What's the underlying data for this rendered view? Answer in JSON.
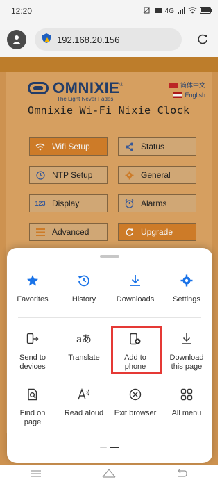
{
  "status_bar": {
    "time": "12:20",
    "network_label": "4G"
  },
  "browser": {
    "url": "192.168.20.156"
  },
  "page": {
    "logo": "OMNIXIE",
    "logo_reg": "®",
    "tagline": "The Light Never Fades",
    "title": "Omnixie Wi-Fi Nixie Clock",
    "languages": [
      {
        "label": "简体中文"
      },
      {
        "label": "English"
      }
    ],
    "buttons": [
      {
        "label": "Wifi Setup",
        "icon": "wifi-icon",
        "active": true
      },
      {
        "label": "Status",
        "icon": "share-icon",
        "active": false
      },
      {
        "label": "NTP Setup",
        "icon": "clock-icon",
        "active": false
      },
      {
        "label": "General",
        "icon": "gear-icon",
        "active": false
      },
      {
        "label": "Display",
        "icon": "digits-icon",
        "active": false
      },
      {
        "label": "Alarms",
        "icon": "alarm-icon",
        "active": false
      },
      {
        "label": "Advanced",
        "icon": "menu-icon",
        "active": false
      },
      {
        "label": "Upgrade",
        "icon": "refresh-icon",
        "active": true
      }
    ]
  },
  "sheet": {
    "row1": [
      {
        "label": "Favorites",
        "icon": "star-icon"
      },
      {
        "label": "History",
        "icon": "history-icon"
      },
      {
        "label": "Downloads",
        "icon": "download-icon"
      },
      {
        "label": "Settings",
        "icon": "settings-icon"
      }
    ],
    "row2": [
      {
        "label": "Send to devices",
        "line1": "Send to",
        "line2": "devices",
        "icon": "send-device-icon"
      },
      {
        "label": "Translate",
        "line1": "Translate",
        "line2": "",
        "icon": "translate-icon"
      },
      {
        "label": "Add to phone",
        "line1": "Add to",
        "line2": "phone",
        "icon": "add-to-phone-icon"
      },
      {
        "label": "Download this page",
        "line1": "Download",
        "line2": "this page",
        "icon": "download-page-icon"
      }
    ],
    "row3": [
      {
        "label": "Find on page",
        "line1": "Find on",
        "line2": "page",
        "icon": "find-icon"
      },
      {
        "label": "Read aloud",
        "line1": "Read aloud",
        "line2": "",
        "icon": "read-aloud-icon"
      },
      {
        "label": "Exit browser",
        "line1": "Exit browser",
        "line2": "",
        "icon": "exit-icon"
      },
      {
        "label": "All menu",
        "line1": "All menu",
        "line2": "",
        "icon": "grid-icon"
      }
    ]
  },
  "colors": {
    "accent_blue": "#1a73e8",
    "highlight_red": "#e53935",
    "page_orange": "#d99a55"
  }
}
